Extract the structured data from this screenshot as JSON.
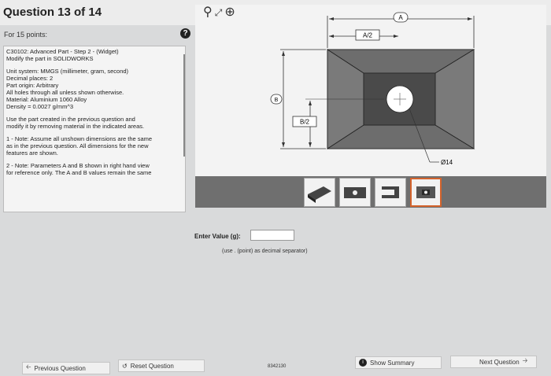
{
  "header": {
    "question_title": "Question 13 of 14",
    "points": "For 15 points:"
  },
  "instructions": {
    "lines_a": [
      "C30102: Advanced Part - Step 2 - (Widget)",
      "Modify the part in SOLIDWORKS"
    ],
    "lines_b": [
      "Unit system: MMGS (millimeter, gram, second)",
      "Decimal places: 2",
      "Part origin: Arbitrary",
      "All holes through all unless shown otherwise.",
      "Material: Aluminium 1060 Alloy",
      "Density = 0.0027 g/mm^3"
    ],
    "lines_c": [
      "Use the part created in the previous question and",
      "modify it by removing material in the indicated areas."
    ],
    "lines_d": [
      "1 - Note: Assume all unshown dimensions are the same",
      "as in the previous question. All dimensions for the new",
      "features are shown."
    ],
    "lines_e": [
      "2 - Note: Parameters A and B shown in right hand view",
      "for reference only. The A and B values remain the same"
    ]
  },
  "drawing": {
    "label_a": "A",
    "label_a_half": "A/2",
    "label_b": "B",
    "label_b_half": "B/2",
    "hole_dim": "Ø14"
  },
  "answer": {
    "label": "Enter Value (g):",
    "value": "",
    "hint": "(use . (point) as decimal separator)"
  },
  "footer": {
    "previous": "Previous Question",
    "reset": "Reset Question",
    "code": "8342130",
    "summary": "Show Summary",
    "next": "Next Question"
  },
  "colors": {
    "accent": "#d4632c",
    "part_dark": "#585858",
    "part_mid": "#7a7a7a",
    "part_face": "#4a4a4a"
  }
}
